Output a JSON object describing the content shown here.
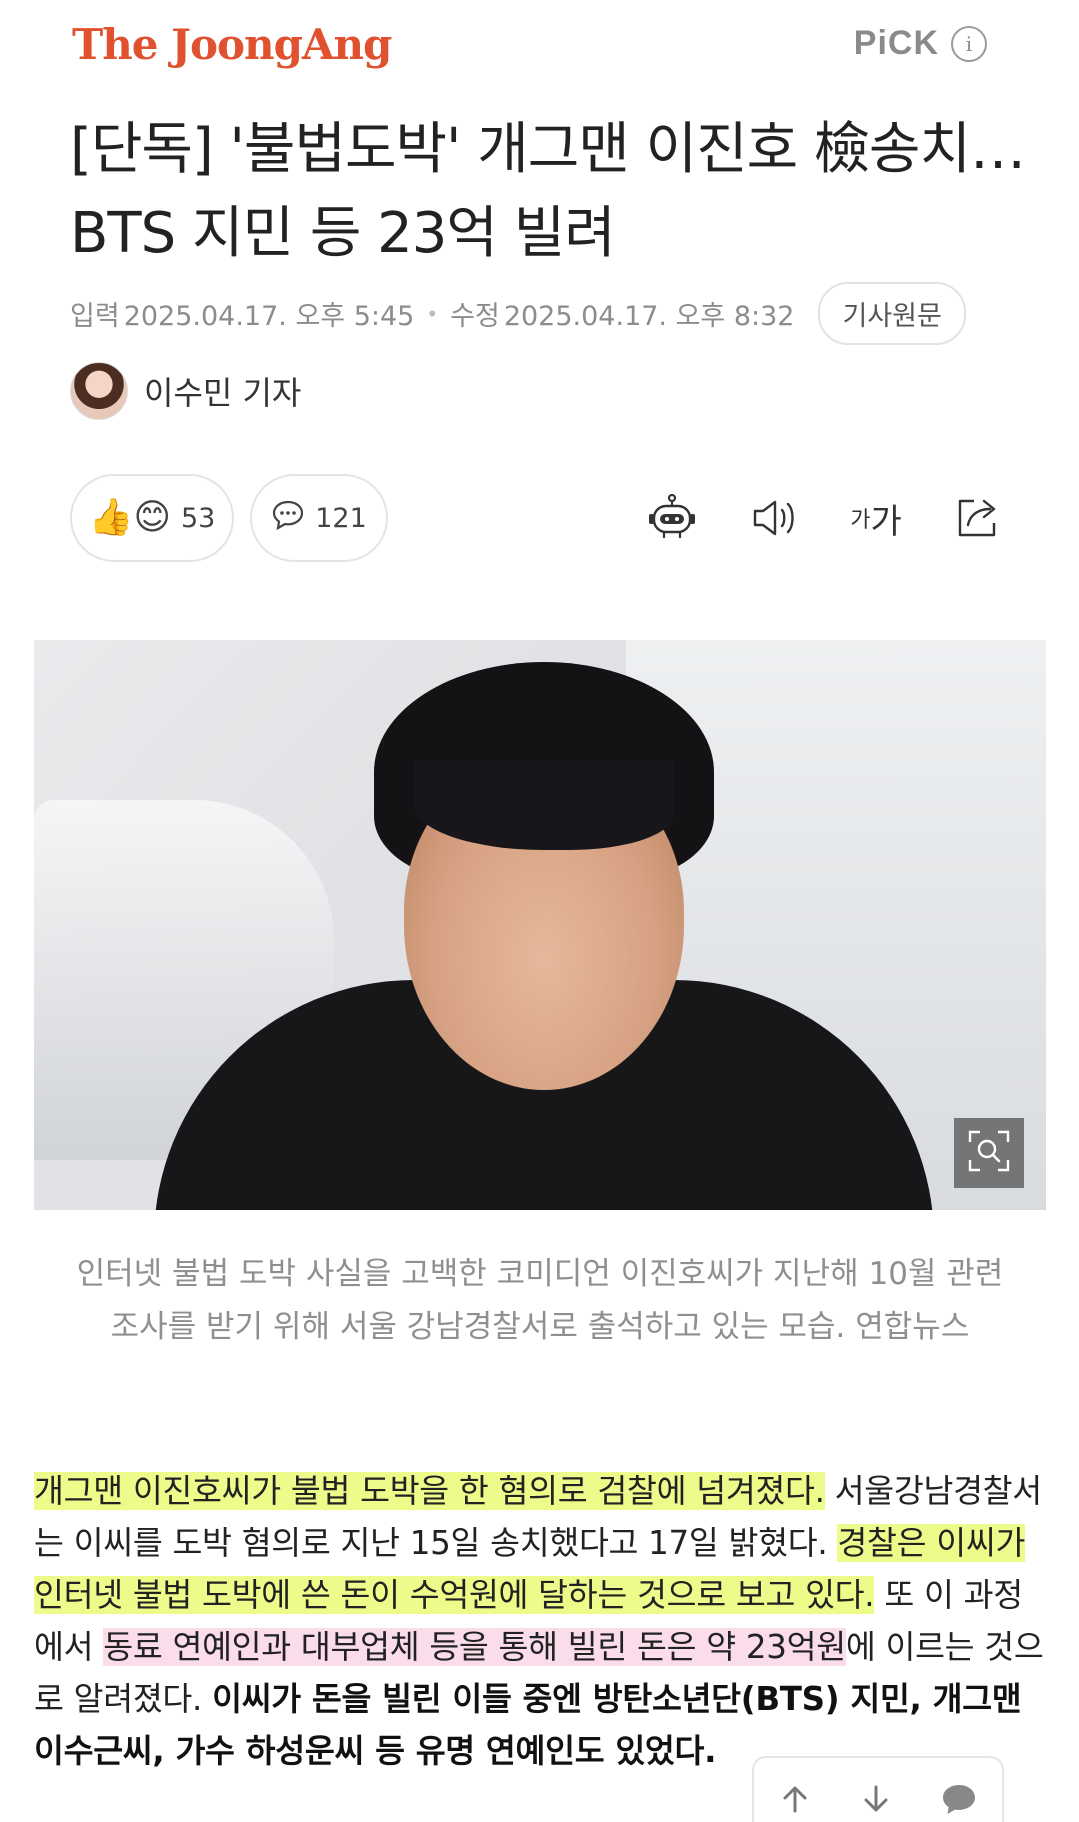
{
  "header": {
    "logo": "The JoongAng",
    "pick_label": "PiCK",
    "info_label": "i"
  },
  "headline": "[단독] '불법도박' 개그맨 이진호 檢송치…BTS 지민 등 23억 빌려",
  "meta": {
    "input_label": "입력",
    "input_time": "2025.04.17. 오후 5:45",
    "modified_label": "수정",
    "modified_time": "2025.04.17. 오후 8:32",
    "original_button": "기사원문"
  },
  "author": {
    "name": "이수민 기자"
  },
  "actions": {
    "reaction_count": "53",
    "comment_count": "121",
    "font_size_small": "가",
    "font_size_large": "가"
  },
  "photo": {
    "caption": "인터넷 불법 도박 사실을 고백한 코미디언 이진호씨가 지난해 10월 관련 조사를 받기 위해 서울 강남경찰서로 출석하고 있는 모습. 연합뉴스"
  },
  "article": {
    "p1_highlight": "개그맨 이진호씨가 불법 도박을 한 혐의로 검찰에 넘겨졌다.",
    "p1_text": " 서울강남경찰서는 이씨를 도박 혐의로 지난 15일 송치했다고 17일 밝혔다. ",
    "p2_highlight": "경찰은 이씨가 인터넷 불법 도박에 쓴 돈이 수억원에 달하는 것으로 보고 있다.",
    "p2_text": " 또 이 과정에서 ",
    "p3_highlight": "동료 연예인과 대부업체 등을 통해 빌린 돈은 약 23억원",
    "p3_text": "에 이르는 것으로 알려졌다. ",
    "p4_bold": "이씨가 돈을 빌린 이들 중엔 방탄소년단(BTS) 지민, 개그맨 이수근씨, 가수 하성운씨 등 유명 연예인도 있었다."
  },
  "colors": {
    "logo": "#e0512f",
    "highlight_yellow": "#ecfb89",
    "highlight_pink": "#fbdcea"
  }
}
